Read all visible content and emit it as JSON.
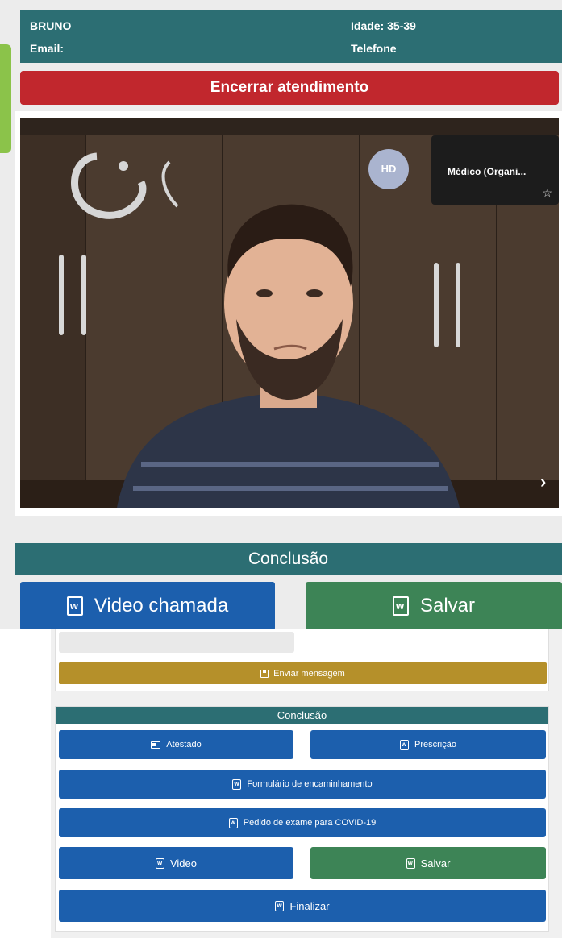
{
  "patient": {
    "name": "BRUNO",
    "email_label": "Email:",
    "age_label": "Idade: 35-39",
    "phone_label": "Telefone"
  },
  "call": {
    "end_label": "Encerrar atendimento",
    "avatar_initials": "HD",
    "remote_participant": "Médico (Organi..."
  },
  "conclusion_top": {
    "title": "Conclusão",
    "video_call_label": "Video chamada",
    "save_label": "Salvar"
  },
  "message": {
    "send_label": "Enviar mensagem"
  },
  "conclusion_bottom": {
    "title": "Conclusão",
    "atestado_label": "Atestado",
    "prescricao_label": "Prescrição",
    "form_label": "Formulário de encaminhamento",
    "covid_label": "Pedido de exame para COVID-19",
    "video_label": "Video",
    "save_label": "Salvar",
    "finish_label": "Finalizar"
  },
  "colors": {
    "teal": "#2c6e73",
    "danger": "#c1272d",
    "primary": "#1c5fad",
    "success": "#3d8456",
    "warning": "#b5902a"
  }
}
